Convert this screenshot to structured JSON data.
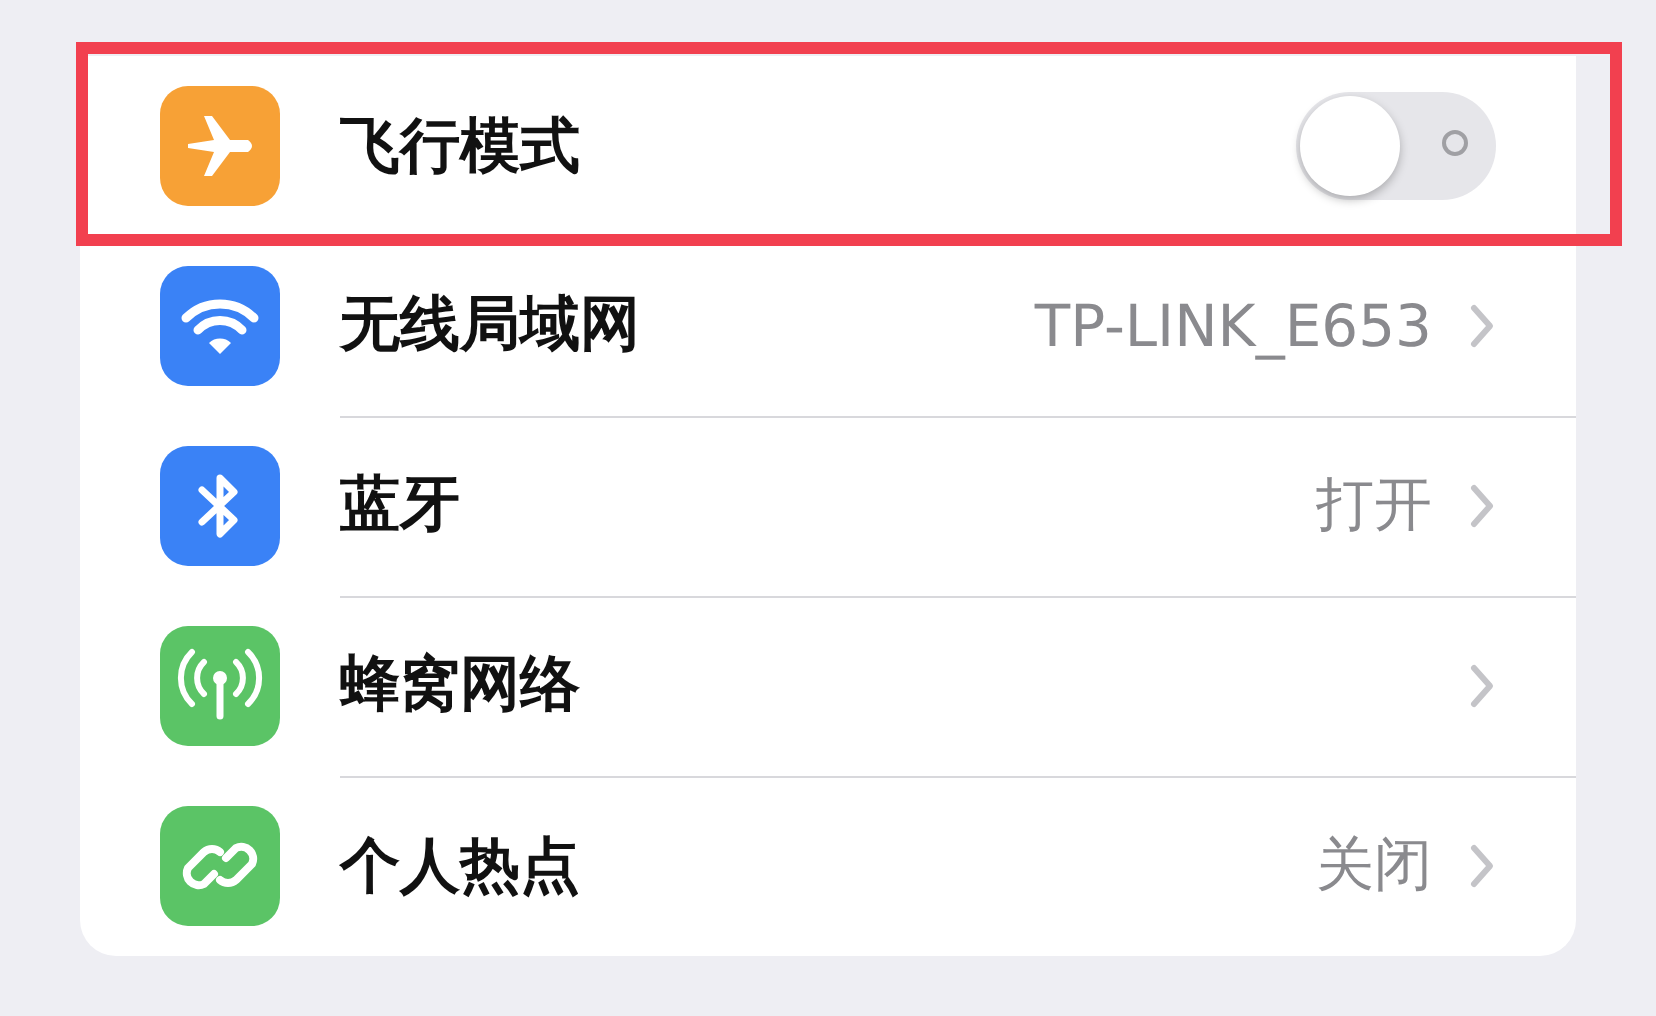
{
  "settings": [
    {
      "kind": "toggle",
      "color": "#f7a136",
      "label": "飞行模式",
      "on": false,
      "highlighted": true
    },
    {
      "kind": "link",
      "color": "#3a82f6",
      "label": "无线局域网",
      "value": "TP-LINK_E653",
      "highlighted": false
    },
    {
      "kind": "link",
      "color": "#3a82f6",
      "label": "蓝牙",
      "value": "打开",
      "highlighted": false
    },
    {
      "kind": "link",
      "color": "#5bc466",
      "label": "蜂窝网络",
      "highlighted": false
    },
    {
      "kind": "link",
      "color": "#5bc466",
      "label": "个人热点",
      "value": "关闭",
      "highlighted": false
    }
  ]
}
